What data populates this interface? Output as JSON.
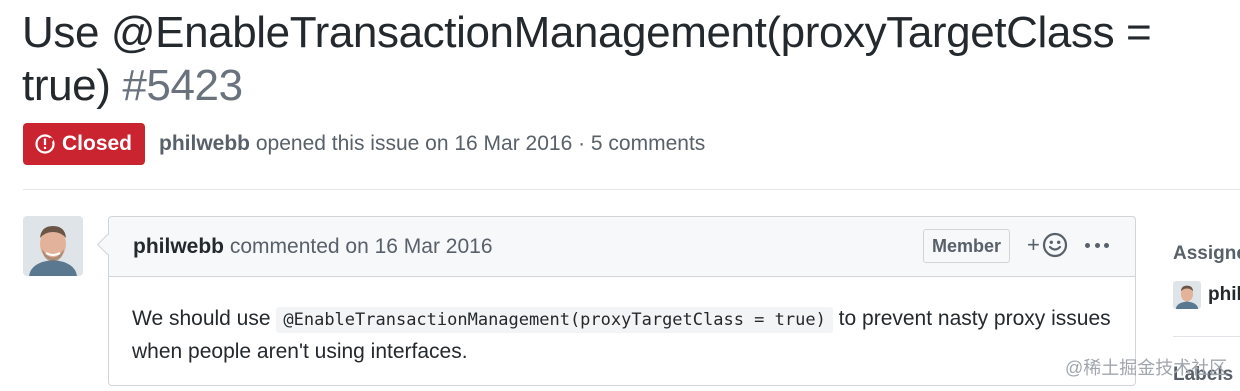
{
  "issue": {
    "title": "Use @EnableTransactionManagement(proxyTargetClass = true)",
    "number": "#5423",
    "state": "Closed",
    "author": "philwebb",
    "opened_text": "opened this issue on 16 Mar 2016 · 5 comments",
    "state_color": "#cb2431"
  },
  "comment": {
    "author": "philwebb",
    "commented_text": "commented on 16 Mar 2016",
    "role_badge": "Member",
    "reaction_plus": "+",
    "body_before": "We should use",
    "body_code": "@EnableTransactionManagement(proxyTargetClass = true)",
    "body_after": "to prevent nasty proxy issues when people aren't using interfaces."
  },
  "sidebar": {
    "assignees_label": "Assignees",
    "assignee_name": "philwebb",
    "labels_label": "Labels"
  },
  "watermark": "@稀土掘金技术社区",
  "icons": [
    "issue-closed-icon",
    "smiley-icon",
    "kebab-icon",
    "avatar"
  ]
}
